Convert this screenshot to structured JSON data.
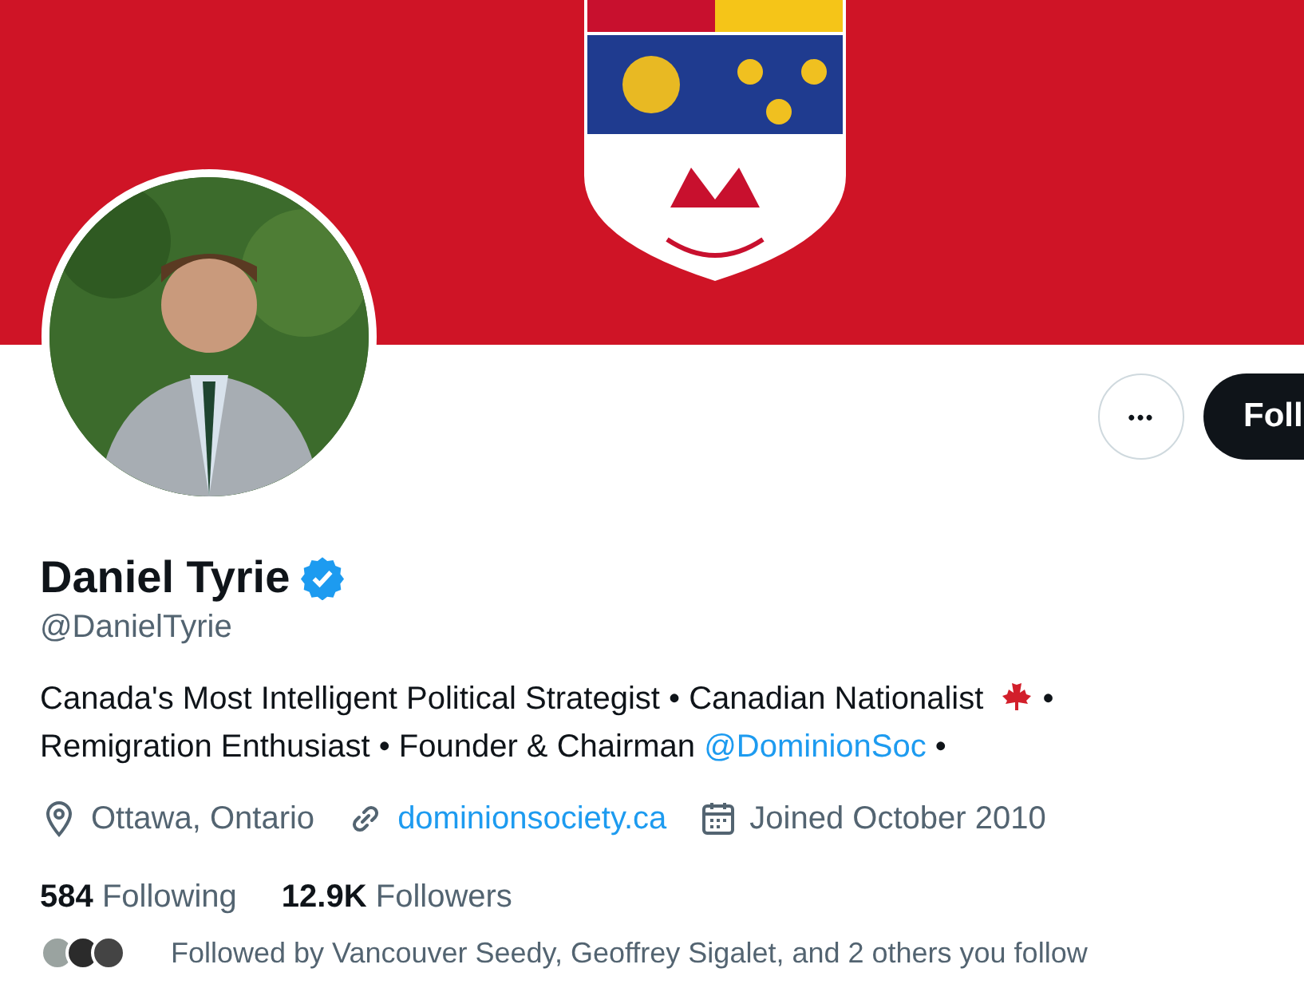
{
  "actions": {
    "more_label": "•••",
    "follow_label": "Foll"
  },
  "profile": {
    "name": "Daniel Tyrie",
    "verified": true,
    "handle": "@DanielTyrie",
    "bio": [
      {
        "kind": "text",
        "text": "Canada's Most Intelligent Political Strategist • Canadian Nationalist "
      },
      {
        "kind": "leaf"
      },
      {
        "kind": "text",
        "text": " • Remigration Enthusiast • Founder & Chairman "
      },
      {
        "kind": "mention",
        "text": "@DominionSoc"
      },
      {
        "kind": "text",
        "text": " •"
      }
    ],
    "meta": [
      {
        "kind": "location",
        "text": "Ottawa, Ontario"
      },
      {
        "kind": "link",
        "text": "dominionsociety.ca"
      },
      {
        "kind": "joined",
        "text": "Joined October 2010"
      }
    ],
    "stats": [
      {
        "count": "584",
        "label": "Following"
      },
      {
        "count": "12.9K",
        "label": "Followers"
      }
    ],
    "followed_by": "Followed by Vancouver Seedy, Geoffrey Sigalet, and 2 others you follow"
  }
}
